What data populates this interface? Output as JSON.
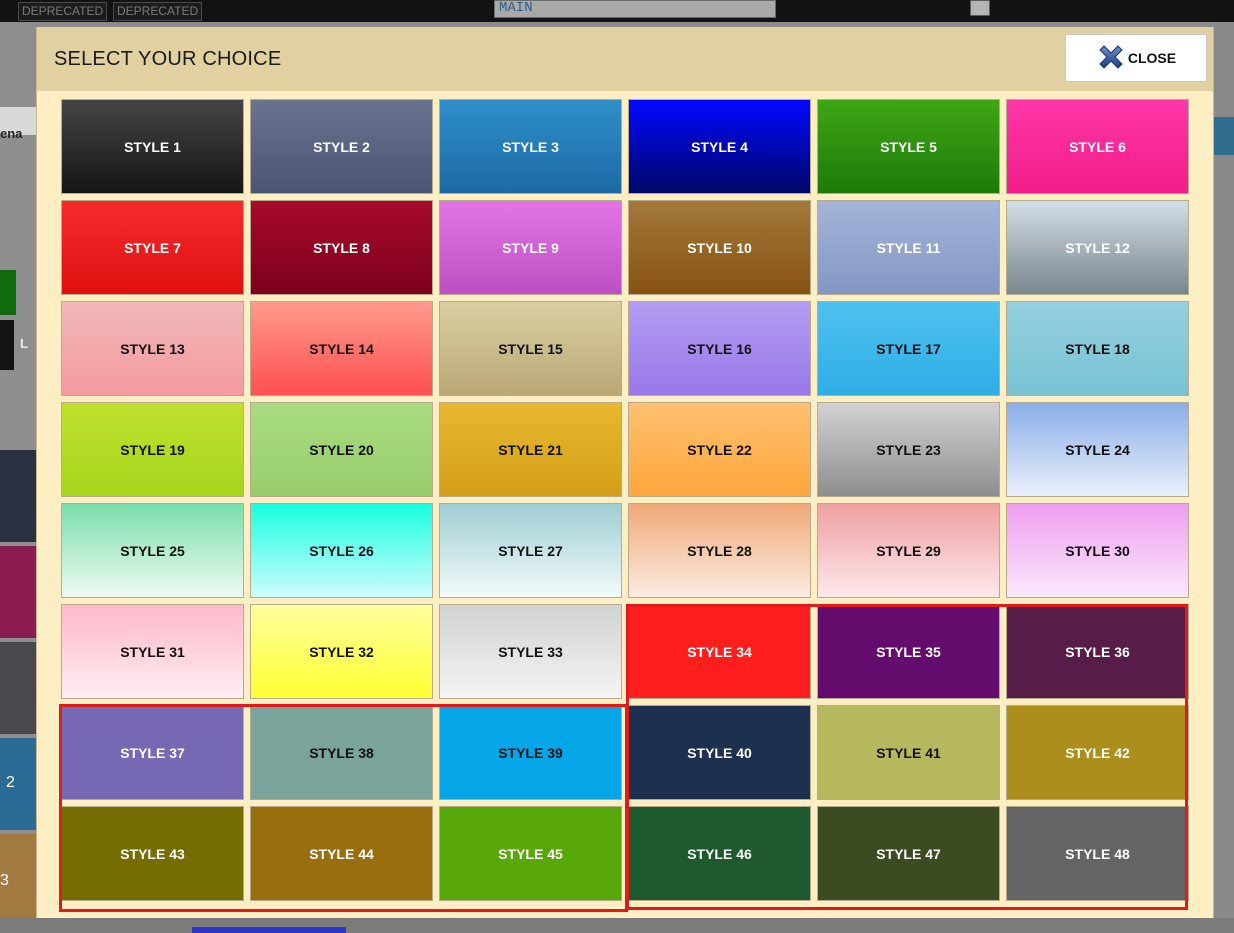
{
  "background": {
    "tags": [
      "DEPRECATED",
      "DEPRECATED"
    ],
    "main_field": "MAIN",
    "left_text_1": "ena",
    "left_text_2": "L",
    "left_text_3": "2",
    "left_text_4": "3"
  },
  "modal": {
    "title": "SELECT YOUR CHOICE",
    "close_label": "CLOSE",
    "close_icon": "close-icon"
  },
  "styles": [
    {
      "label": "STYLE 1",
      "bg": "linear-gradient(#454545,#151515)",
      "fg": "#ffffff"
    },
    {
      "label": "STYLE 2",
      "bg": "linear-gradient(#6a7490,#4b5472)",
      "fg": "#ffffff"
    },
    {
      "label": "STYLE 3",
      "bg": "linear-gradient(#2f8fc9,#1c6aa4)",
      "fg": "#ffffff"
    },
    {
      "label": "STYLE 4",
      "bg": "linear-gradient(#0008ff,#000766)",
      "fg": "#ffffff"
    },
    {
      "label": "STYLE 5",
      "bg": "linear-gradient(#3ea616,#1d7a08)",
      "fg": "#ffffff"
    },
    {
      "label": "STYLE 6",
      "bg": "linear-gradient(#ff37a8,#f21c8a)",
      "fg": "#ffffff"
    },
    {
      "label": "STYLE 7",
      "bg": "linear-gradient(#f52b2b,#de1010)",
      "fg": "#ffffff"
    },
    {
      "label": "STYLE 8",
      "bg": "linear-gradient(#a80a2a,#7c001c)",
      "fg": "#ffffff"
    },
    {
      "label": "STYLE 9",
      "bg": "linear-gradient(#e276e6,#bc4fc3)",
      "fg": "#ffffff"
    },
    {
      "label": "STYLE 10",
      "bg": "linear-gradient(#a37939,#875312)",
      "fg": "#ffffff"
    },
    {
      "label": "STYLE 11",
      "bg": "linear-gradient(#a4b5d8,#8497c4)",
      "fg": "#ffffff"
    },
    {
      "label": "STYLE 12",
      "bg": "linear-gradient(#d4dde6,#78868f)",
      "fg": "#ffffff"
    },
    {
      "label": "STYLE 13",
      "bg": "linear-gradient(#f0b8b8,#f59aa0)",
      "fg": "#111111"
    },
    {
      "label": "STYLE 14",
      "bg": "linear-gradient(#ff9a8c,#ff5050)",
      "fg": "#111111"
    },
    {
      "label": "STYLE 15",
      "bg": "linear-gradient(#d8cea2,#bba976)",
      "fg": "#111111"
    },
    {
      "label": "STYLE 16",
      "bg": "linear-gradient(#b29cf2,#9a78e8)",
      "fg": "#111111"
    },
    {
      "label": "STYLE 17",
      "bg": "linear-gradient(#4fc1ee,#2eaee6)",
      "fg": "#111111"
    },
    {
      "label": "STYLE 18",
      "bg": "linear-gradient(#95d0de,#78c2d4)",
      "fg": "#111111"
    },
    {
      "label": "STYLE 19",
      "bg": "linear-gradient(#c0e02e,#a6d61c)",
      "fg": "#111111"
    },
    {
      "label": "STYLE 20",
      "bg": "linear-gradient(#aadc82,#98cc6a)",
      "fg": "#111111"
    },
    {
      "label": "STYLE 21",
      "bg": "linear-gradient(#e8b830,#d39e18)",
      "fg": "#111111"
    },
    {
      "label": "STYLE 22",
      "bg": "linear-gradient(#ffc070,#ffa63c)",
      "fg": "#111111"
    },
    {
      "label": "STYLE 23",
      "bg": "linear-gradient(#d2d2d2,#8e8e8e)",
      "fg": "#111111"
    },
    {
      "label": "STYLE 24",
      "bg": "linear-gradient(#8aaee8,#eaf0fb)",
      "fg": "#111111"
    },
    {
      "label": "STYLE 25",
      "bg": "linear-gradient(#78ddac,#f0faf2)",
      "fg": "#111111"
    },
    {
      "label": "STYLE 26",
      "bg": "linear-gradient(#18ffe0,#cffcff)",
      "fg": "#111111"
    },
    {
      "label": "STYLE 27",
      "bg": "linear-gradient(#9ecdd2,#f2fbfb)",
      "fg": "#111111"
    },
    {
      "label": "STYLE 28",
      "bg": "linear-gradient(#f0a878,#fcece2)",
      "fg": "#111111"
    },
    {
      "label": "STYLE 29",
      "bg": "linear-gradient(#eea0a0,#fde8ea)",
      "fg": "#111111"
    },
    {
      "label": "STYLE 30",
      "bg": "linear-gradient(#ee9ef0,#fae8fb)",
      "fg": "#111111"
    },
    {
      "label": "STYLE 31",
      "bg": "linear-gradient(#ffb8ca,#ffeef2)",
      "fg": "#111111"
    },
    {
      "label": "STYLE 32",
      "bg": "linear-gradient(#ffff9c,#ffff33)",
      "fg": "#111111"
    },
    {
      "label": "STYLE 33",
      "bg": "linear-gradient(#d2d2d2,#f4f4f4)",
      "fg": "#111111"
    },
    {
      "label": "STYLE 34",
      "bg": "#ff1e1e",
      "fg": "#ffffff"
    },
    {
      "label": "STYLE 35",
      "bg": "#630c6e",
      "fg": "#ffffff"
    },
    {
      "label": "STYLE 36",
      "bg": "#571c47",
      "fg": "#ffffff"
    },
    {
      "label": "STYLE 37",
      "bg": "#7668b2",
      "fg": "#ffffff"
    },
    {
      "label": "STYLE 38",
      "bg": "#79a39b",
      "fg": "#111111"
    },
    {
      "label": "STYLE 39",
      "bg": "#04a6e8",
      "fg": "#111111"
    },
    {
      "label": "STYLE 40",
      "bg": "#1d3050",
      "fg": "#ffffff"
    },
    {
      "label": "STYLE 41",
      "bg": "#b6b85e",
      "fg": "#111111"
    },
    {
      "label": "STYLE 42",
      "bg": "#ac8e1c",
      "fg": "#ffffff"
    },
    {
      "label": "STYLE 43",
      "bg": "#756c02",
      "fg": "#ffffff"
    },
    {
      "label": "STYLE 44",
      "bg": "#996e0e",
      "fg": "#ffffff"
    },
    {
      "label": "STYLE 45",
      "bg": "#58a80a",
      "fg": "#ffffff"
    },
    {
      "label": "STYLE 46",
      "bg": "#1f5a2e",
      "fg": "#ffffff"
    },
    {
      "label": "STYLE 47",
      "bg": "#3c4c22",
      "fg": "#ffffff"
    },
    {
      "label": "STYLE 48",
      "bg": "#646464",
      "fg": "#ffffff"
    }
  ],
  "highlight_color": "#e21a1a"
}
